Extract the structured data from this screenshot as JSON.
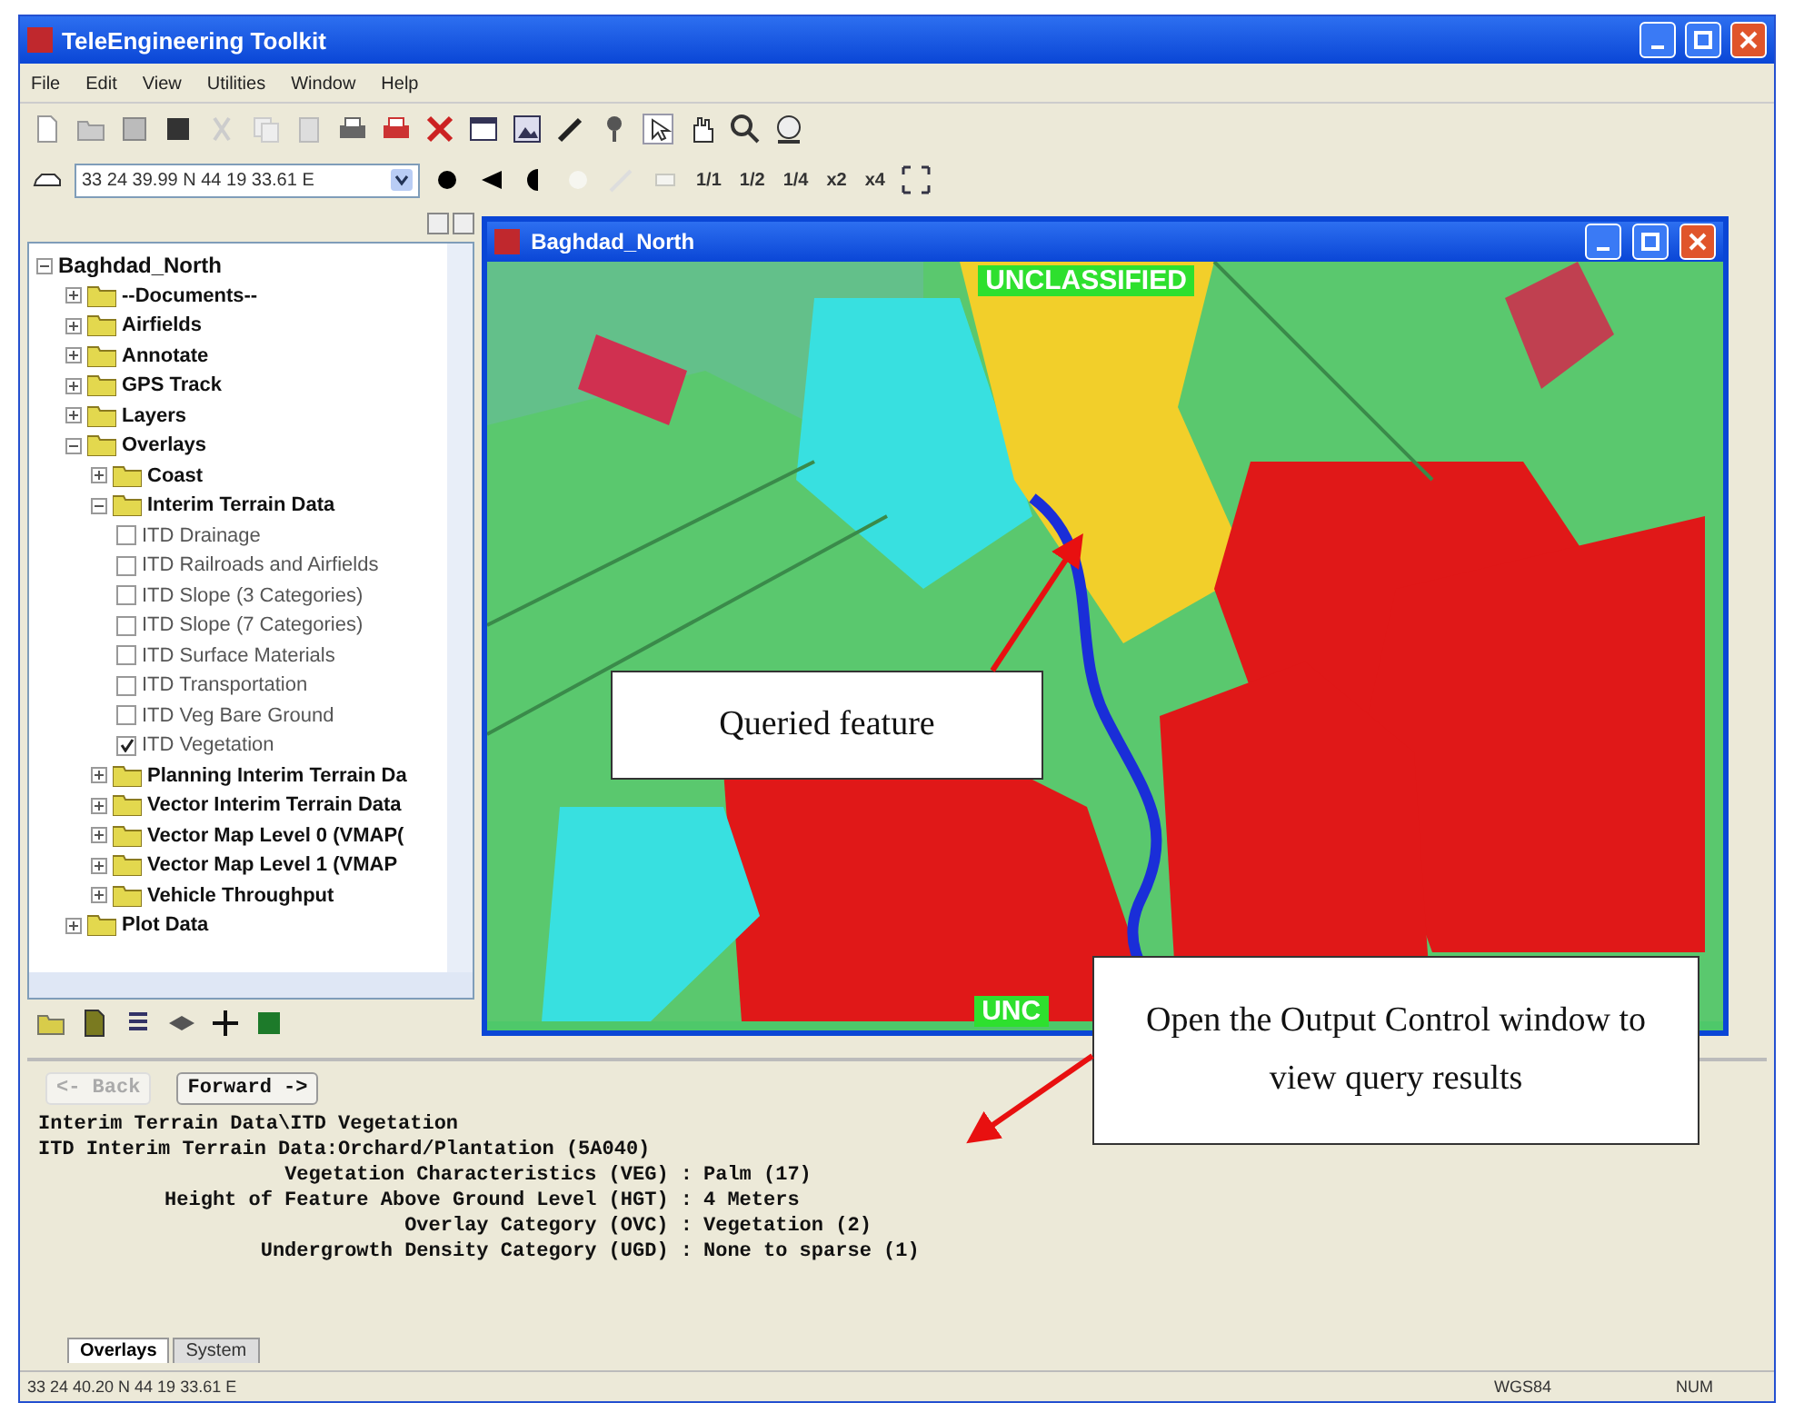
{
  "window": {
    "title": "TeleEngineering Toolkit"
  },
  "menu": [
    "File",
    "Edit",
    "View",
    "Utilities",
    "Window",
    "Help"
  ],
  "coordinate_field": {
    "value": "33 24 39.99 N  44 19 33.61 E"
  },
  "zoom_buttons": [
    "1/1",
    "1/2",
    "1/4",
    "x2",
    "x4"
  ],
  "tree": {
    "items": [
      {
        "label": "Baghdad_North",
        "kind": "root",
        "expanded": true,
        "children": [
          {
            "label": "--Documents--",
            "kind": "folder",
            "expanded": false
          },
          {
            "label": "Airfields",
            "kind": "folder",
            "expanded": false
          },
          {
            "label": "Annotate",
            "kind": "folder",
            "expanded": false
          },
          {
            "label": "GPS Track",
            "kind": "folder",
            "expanded": false
          },
          {
            "label": "Layers",
            "kind": "folder",
            "expanded": false
          },
          {
            "label": "Overlays",
            "kind": "folder",
            "expanded": true,
            "children": [
              {
                "label": "Coast",
                "kind": "folder",
                "expanded": false
              },
              {
                "label": "Interim Terrain Data",
                "kind": "folder",
                "expanded": true,
                "children": [
                  {
                    "label": "ITD Drainage",
                    "kind": "checkbox",
                    "checked": false
                  },
                  {
                    "label": "ITD Railroads and Airfields",
                    "kind": "checkbox",
                    "checked": false
                  },
                  {
                    "label": "ITD Slope (3 Categories)",
                    "kind": "checkbox",
                    "checked": false
                  },
                  {
                    "label": "ITD Slope (7 Categories)",
                    "kind": "checkbox",
                    "checked": false
                  },
                  {
                    "label": "ITD Surface Materials",
                    "kind": "checkbox",
                    "checked": false
                  },
                  {
                    "label": "ITD Transportation",
                    "kind": "checkbox",
                    "checked": false
                  },
                  {
                    "label": "ITD Veg Bare Ground",
                    "kind": "checkbox",
                    "checked": false
                  },
                  {
                    "label": "ITD Vegetation",
                    "kind": "checkbox",
                    "checked": true
                  }
                ]
              },
              {
                "label": "Planning Interim Terrain Da",
                "kind": "folder",
                "expanded": false
              },
              {
                "label": "Vector Interim Terrain Data",
                "kind": "folder",
                "expanded": false
              },
              {
                "label": "Vector Map Level 0 (VMAP(",
                "kind": "folder",
                "expanded": false
              },
              {
                "label": "Vector Map Level 1 (VMAP",
                "kind": "folder",
                "expanded": false
              },
              {
                "label": "Vehicle Throughput",
                "kind": "folder",
                "expanded": false
              }
            ]
          },
          {
            "label": "Plot Data",
            "kind": "folder",
            "expanded": false
          }
        ]
      }
    ]
  },
  "map_window": {
    "title": "Baghdad_North",
    "banners": [
      "UNCLASSIFIED",
      "UNC"
    ]
  },
  "callouts": [
    "Queried feature",
    "Open the Output Control window to view query results"
  ],
  "output": {
    "back": {
      "label": "<- Back",
      "disabled": true
    },
    "forward": {
      "label": "Forward ->",
      "disabled": false
    },
    "lines": [
      "Interim Terrain Data\\ITD Vegetation",
      "ITD Interim Terrain Data:Orchard/Plantation (5A040)"
    ],
    "fields": [
      {
        "label": "Vegetation Characteristics (VEG) :",
        "value": "Palm (17)"
      },
      {
        "label": "Height of Feature Above Ground Level (HGT) :",
        "value": "4 Meters"
      },
      {
        "label": "Overlay Category (OVC) :",
        "value": "Vegetation (2)"
      },
      {
        "label": "Undergrowth Density Category (UGD) :",
        "value": "None to sparse (1)"
      }
    ],
    "tabs": [
      {
        "label": "Overlays",
        "selected": true
      },
      {
        "label": "System",
        "selected": false
      }
    ]
  },
  "status_bar": {
    "coordinates": "33 24 40.20 N  44 19 33.61 E",
    "datum": "WGS84",
    "num": "NUM"
  }
}
